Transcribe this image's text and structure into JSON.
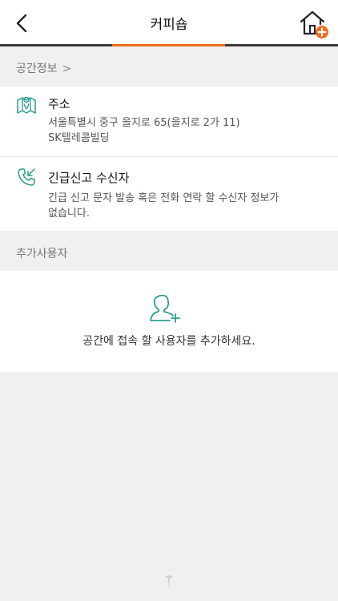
{
  "header": {
    "title": "커피숍"
  },
  "sections": {
    "space_info_label": "공간정보",
    "extra_users_label": "추가사용자"
  },
  "address": {
    "title": "주소",
    "line1": "서울특별시 중구 을지로 65(을지로 2가 11)",
    "line2": "SK텔레콤빌딩"
  },
  "emergency": {
    "title": "긴급신고 수신자",
    "line1": "긴급 신고 문자 발송 혹은 전화 연락 할 수신자 정보가",
    "line2": "없습니다."
  },
  "extra_users": {
    "empty_message": "공간에 접속 할 사용자를 추가하세요."
  },
  "colors": {
    "accent": "#f26a21",
    "teal": "#2a9d8f",
    "background": "#f0f0f0"
  },
  "icons": [
    "back-chevron-icon",
    "home-add-icon",
    "map-icon",
    "phone-incoming-icon",
    "add-user-icon",
    "brand-logo-icon"
  ]
}
